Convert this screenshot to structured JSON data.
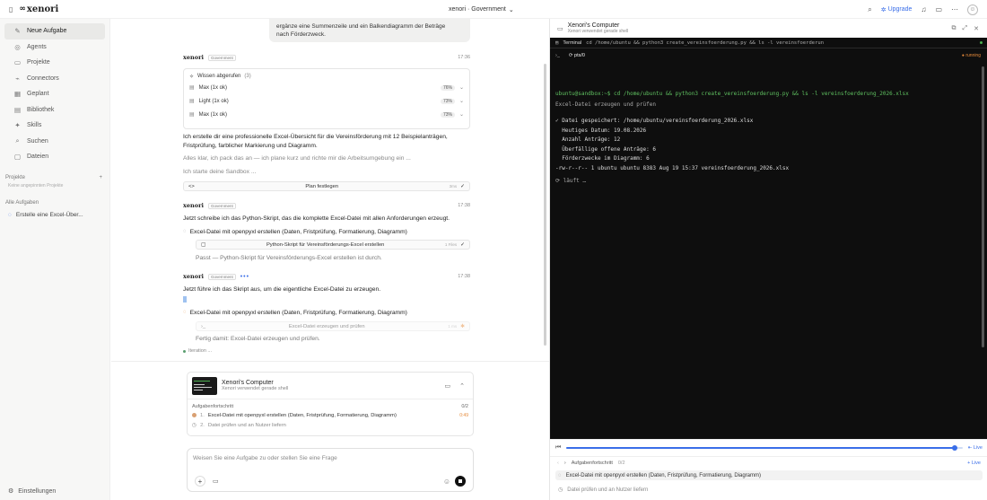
{
  "app": {
    "logo_text": "xenori",
    "workspace": "xenori · Government",
    "upgrade_label": "Upgrade"
  },
  "sidebar": {
    "items": [
      {
        "label": "Neue Aufgabe",
        "icon": "edit-icon"
      },
      {
        "label": "Agents",
        "icon": "agents-icon"
      },
      {
        "label": "Projekte",
        "icon": "folder-icon"
      },
      {
        "label": "Connectors",
        "icon": "connector-icon"
      },
      {
        "label": "Geplant",
        "icon": "calendar-icon"
      },
      {
        "label": "Bibliothek",
        "icon": "book-icon"
      },
      {
        "label": "Skills",
        "icon": "spark-icon"
      },
      {
        "label": "Suchen",
        "icon": "search-icon"
      },
      {
        "label": "Dateien",
        "icon": "file-icon"
      }
    ],
    "projects_label": "Projekte",
    "projects_empty": "Keine angepinnten Projekte",
    "all_tasks_label": "Alle Aufgaben",
    "tasks": [
      "Erstelle eine Excel-Über..."
    ],
    "settings_label": "Einstellungen"
  },
  "chat": {
    "user_bubble_lines": [
      "ergänze eine Summenzeile und ein Balkendiagramm der Beträge",
      "nach Förderzweck."
    ],
    "agent_name": "xenori",
    "agent_badge": "Government",
    "msg1": {
      "time": "17:36",
      "knowledge_title": "Wissen abgerufen",
      "knowledge_count": "(3)",
      "knowledge": [
        {
          "label": "Max (1x ok)",
          "pct": "76%"
        },
        {
          "label": "Light (1x ok)",
          "pct": "73%"
        },
        {
          "label": "Max (1x ok)",
          "pct": "73%"
        }
      ],
      "text": "Ich erstelle dir eine professionelle Excel-Übersicht für die Vereinsförderung mit 12 Beispielanträgen, Fristprüfung, farblicher Markierung und Diagramm.",
      "muted1": "Alles klar, ich pack das an — ich plane kurz und richte mir die Arbeitsumgebung ein ...",
      "muted2": "Ich starte deine Sandbox ...",
      "plan_label": "Plan festlegen",
      "plan_meta": "3ms"
    },
    "msg2": {
      "time": "17:38",
      "text": "Jetzt schreibe ich das Python-Skript, das die komplette Excel-Datei mit allen Anforderungen erzeugt.",
      "step": "Excel-Datei mit openpyxl erstellen (Daten, Fristprüfung, Formatierung, Diagramm)",
      "file_label": "Python-Skript für Vereinsförderungs-Excel erstellen",
      "file_meta": "1 Files",
      "done_text": "Passt — Python-Skript für Vereinsförderungs-Excel erstellen ist durch."
    },
    "msg3": {
      "time": "17:38",
      "text": "Jetzt führe ich das Skript aus, um die eigentliche Excel-Datei zu erzeugen.",
      "step": "Excel-Datei mit openpyxl erstellen (Daten, Fristprüfung, Formatierung, Diagramm)",
      "running_label": "Excel-Datei erzeugen und prüfen",
      "running_meta": "1 ms",
      "done_text": "Fertig damit: Excel-Datei erzeugen und prüfen."
    },
    "iteration": "Iteration ..."
  },
  "computer": {
    "title": "Xenori's Computer",
    "subtitle": "Xenori verwendet gerade shell",
    "progress_label": "Aufgabenfortschritt",
    "progress_count": "0/2",
    "steps": [
      {
        "num": "1.",
        "label": "Excel-Datei mit openpyxl erstellen (Daten, Fristprüfung, Formatierung, Diagramm)",
        "time": "0:49"
      },
      {
        "num": "2.",
        "label": "Datei prüfen und an Nutzer liefern"
      }
    ]
  },
  "input": {
    "placeholder": "Weisen Sie eine Aufgabe zu oder stellen Sie eine Frage"
  },
  "panel": {
    "title": "Xenori's Computer",
    "subtitle": "Xenori verwendet gerade shell",
    "term_label": "Terminal",
    "term_cmd": "cd /home/ubuntu && python3 create_vereinsfoerderung.py && ls -l vereinsfoerderun",
    "tab_label": "pts/0",
    "status": "running",
    "lines": [
      {
        "text": "ubuntu@sandbox:~$ cd /home/ubuntu && python3 create_vereinsfoerderung.py && ls -l vereinsfoerderung_2026.xlsx",
        "cls": "green"
      },
      {
        "text": "Excel-Datei erzeugen und prüfen",
        "cls": "muted"
      },
      {
        "text": "✓ Datei gespeichert: /home/ubuntu/vereinsfoerderung_2026.xlsx",
        "cls": ""
      },
      {
        "text": "  Heutiges Datum: 19.08.2026",
        "cls": ""
      },
      {
        "text": "  Anzahl Anträge: 12",
        "cls": ""
      },
      {
        "text": "  Überfällige offene Anträge: 6",
        "cls": ""
      },
      {
        "text": "  Förderzwecke im Diagramm: 6",
        "cls": ""
      },
      {
        "text": "-rw-r--r-- 1 ubuntu ubuntu 8383 Aug 19 15:37 vereinsfoerderung_2026.xlsx",
        "cls": ""
      },
      {
        "text": "⟳ läuft …",
        "cls": "muted"
      }
    ],
    "live_label": "Live",
    "timeline_fraction": 0.98,
    "progress_label": "Aufgabenfortschritt",
    "progress_count": "0/2",
    "steps": [
      "Excel-Datei mit openpyxl erstellen (Daten, Fristprüfung, Formatierung, Diagramm)",
      "Datei prüfen und an Nutzer liefern"
    ]
  }
}
